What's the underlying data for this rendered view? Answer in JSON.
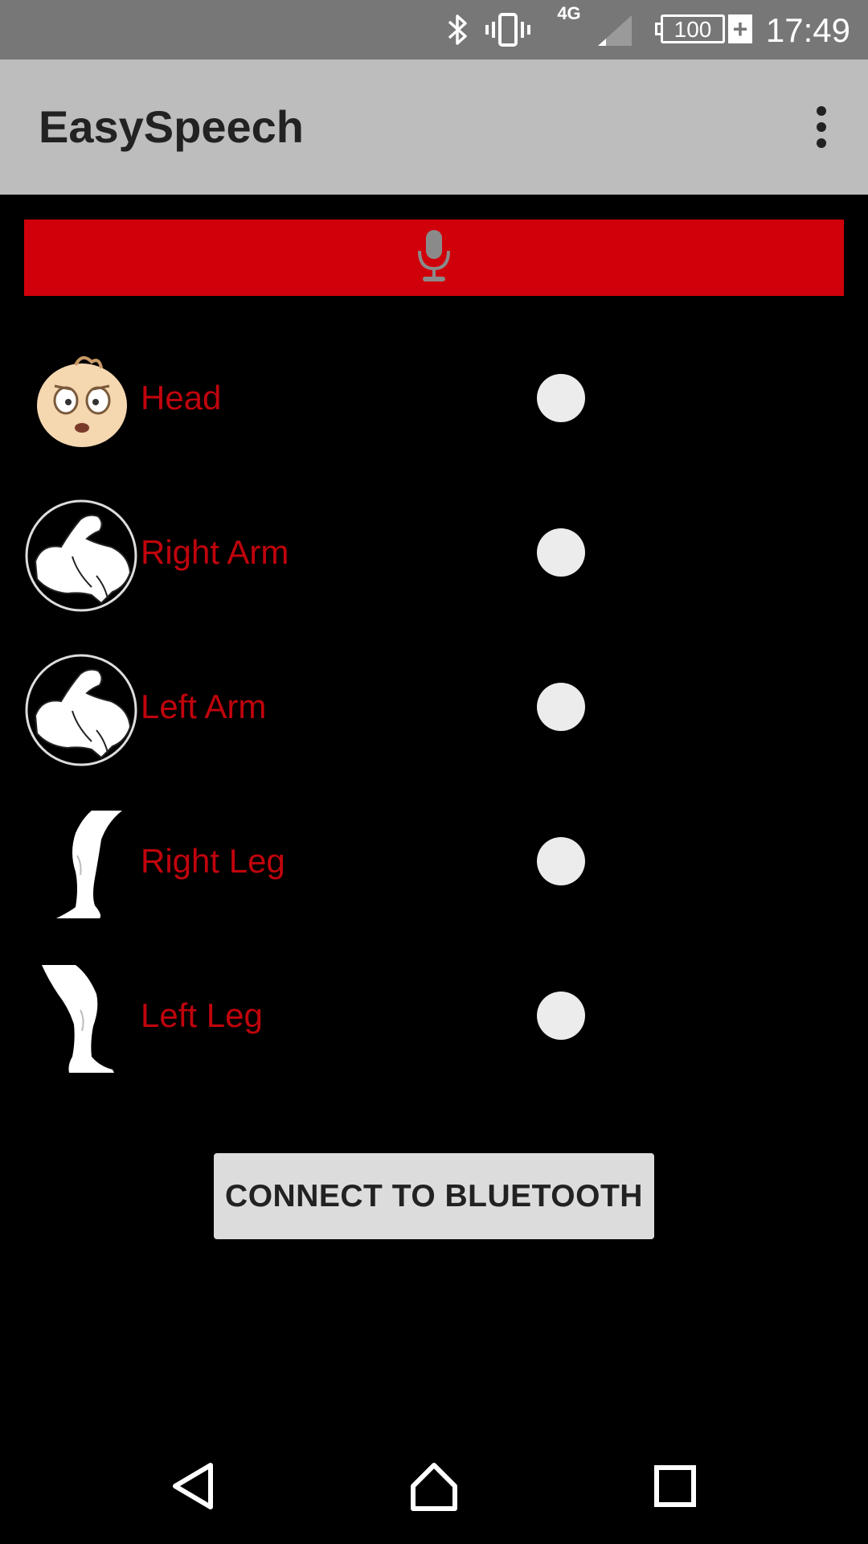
{
  "status_bar": {
    "network_type": "4G",
    "battery_level": "100",
    "battery_charging_symbol": "+",
    "time": "17:49",
    "icons": [
      "bluetooth-icon",
      "vibrate-icon",
      "signal-icon",
      "battery-icon"
    ]
  },
  "app_bar": {
    "title": "EasySpeech",
    "menu_icon": "more-vert-icon"
  },
  "mic_bar": {
    "icon": "microphone-icon",
    "color": "#d0000a"
  },
  "body_parts": [
    {
      "label": "Head",
      "icon": "head-face-icon",
      "selected": false
    },
    {
      "label": "Right Arm",
      "icon": "flexed-arm-icon",
      "selected": false
    },
    {
      "label": "Left Arm",
      "icon": "flexed-arm-icon",
      "selected": false
    },
    {
      "label": "Right Leg",
      "icon": "leg-icon",
      "selected": false
    },
    {
      "label": "Left Leg",
      "icon": "leg-icon",
      "selected": false
    }
  ],
  "connect_button": {
    "label": "CONNECT TO BLUETOOTH"
  },
  "nav_bar": {
    "icons": [
      "back-icon",
      "home-icon",
      "recents-icon"
    ]
  },
  "colors": {
    "label_red": "#c0040c",
    "app_bar_bg": "#bdbdbd",
    "status_bar_bg": "#777777",
    "background": "#000000"
  }
}
